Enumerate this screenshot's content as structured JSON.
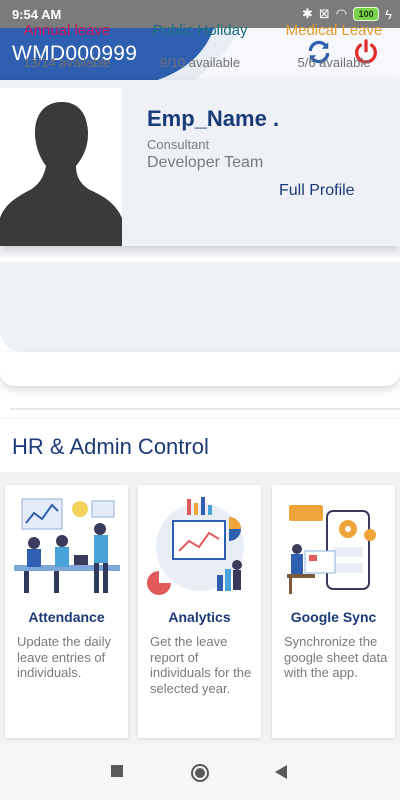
{
  "status_bar": {
    "time": "9:54 AM",
    "battery": "100"
  },
  "header": {
    "employee_id": "WMD000999",
    "refresh_icon": "refresh-icon",
    "power_icon": "power-icon"
  },
  "profile": {
    "name": "Emp_Name .",
    "designation": "Consultant",
    "team": "Developer Team",
    "full_profile_label": "Full Profile"
  },
  "leaves": [
    {
      "label": "Annual leave",
      "available": "13/14 available",
      "color": "#c2185b"
    },
    {
      "label": "Public Holiday",
      "available": "9/10 available",
      "color": "#1b6f7f"
    },
    {
      "label": "Medical Leave",
      "available": "5/6 available",
      "color": "#e39a2d"
    }
  ],
  "section": {
    "title": "HR & Admin Control"
  },
  "cards": [
    {
      "title": "Attendance",
      "desc": "Update the daily leave entries of individuals."
    },
    {
      "title": "Analytics",
      "desc": "Get the leave report of individuals for the selected year."
    },
    {
      "title": "Google Sync",
      "desc": "Synchronize the google sheet data with the app."
    }
  ],
  "colors": {
    "brand_blue": "#1b3a78",
    "header_blue": "#2f5fb0",
    "accent_red": "#e22b2b"
  },
  "nav": {
    "recents_icon": "square-icon",
    "home_icon": "circle-icon",
    "back_icon": "triangle-back-icon"
  }
}
